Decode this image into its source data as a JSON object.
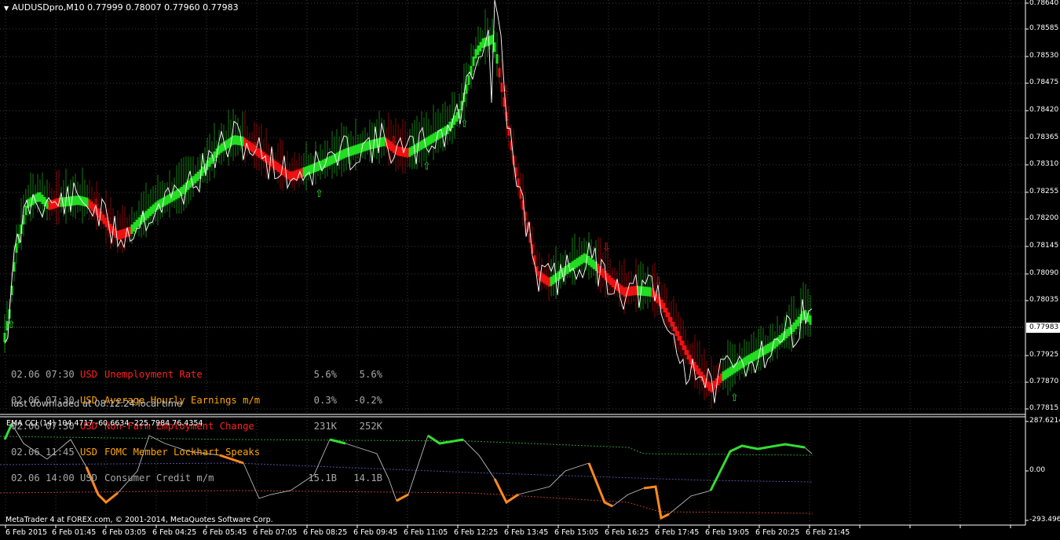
{
  "symbol_header": "AUDUSDpro,M10  0.77999 0.78007 0.77960 0.77983",
  "price_axis": {
    "ticks": [
      "0.78640",
      "0.78585",
      "0.78530",
      "0.78475",
      "0.78420",
      "0.78365",
      "0.78310",
      "0.78255",
      "0.78200",
      "0.78145",
      "0.78090",
      "0.78035",
      "0.77925",
      "0.77870",
      "0.77815"
    ],
    "current_price": "0.77983"
  },
  "time_axis": [
    "6 Feb 2015",
    "6 Feb 01:45",
    "6 Feb 03:05",
    "6 Feb 04:25",
    "6 Feb 05:45",
    "6 Feb 07:05",
    "6 Feb 08:25",
    "6 Feb 09:45",
    "6 Feb 11:05",
    "6 Feb 12:25",
    "6 Feb 13:45",
    "6 Feb 15:05",
    "6 Feb 16:25",
    "6 Feb 17:45",
    "6 Feb 19:05",
    "6 Feb 20:25",
    "6 Feb 21:45"
  ],
  "news": [
    {
      "datetime": "02.06 07:30",
      "currency": "USD",
      "event": "Unemployment Rate",
      "actual": "5.6%",
      "forecast": "5.6%",
      "color": "#ff2020"
    },
    {
      "datetime": "02.06 07:30",
      "currency": "USD",
      "event": "Average Hourly Earnings m/m",
      "actual": "0.3%",
      "forecast": "-0.2%",
      "color": "#ffa500"
    },
    {
      "datetime": "02.06 07:30",
      "currency": "USD",
      "event": "Non-Farm Employment Change",
      "actual": "231K",
      "forecast": "252K",
      "color": "#ff2020"
    },
    {
      "datetime": "02.06 11:45",
      "currency": "USD",
      "event": "FOMC Member Lockhart Speaks",
      "actual": "",
      "forecast": "",
      "color": "#ffa500"
    },
    {
      "datetime": "02.06 14:00",
      "currency": "USD",
      "event": "Consumer Credit m/m",
      "actual": "15.1B",
      "forecast": "14.1B",
      "color": "#a7a7a7"
    }
  ],
  "download_text": "last downladed at 08:12:24 local time",
  "indicator": {
    "header": "EMA CCI (14) 104.4717 -60.6634 -225.7984 76.4354",
    "ticks": [
      "287.6214",
      "0.00",
      "-293.4967"
    ]
  },
  "copyright": "MetaTrader 4 at FOREX.com, © 2001-2014, MetaQuotes Software Corp.",
  "colors": {
    "bull": "#22dd22",
    "bear": "#ee1111",
    "price_line": "#ffffff",
    "cci_up": "#33dd33",
    "cci_down": "#ff8a1c",
    "level_top": "#2a9a2a",
    "level_mid": "#5050a0",
    "level_bottom": "#b04020",
    "grid": "#3a3a3a"
  }
}
